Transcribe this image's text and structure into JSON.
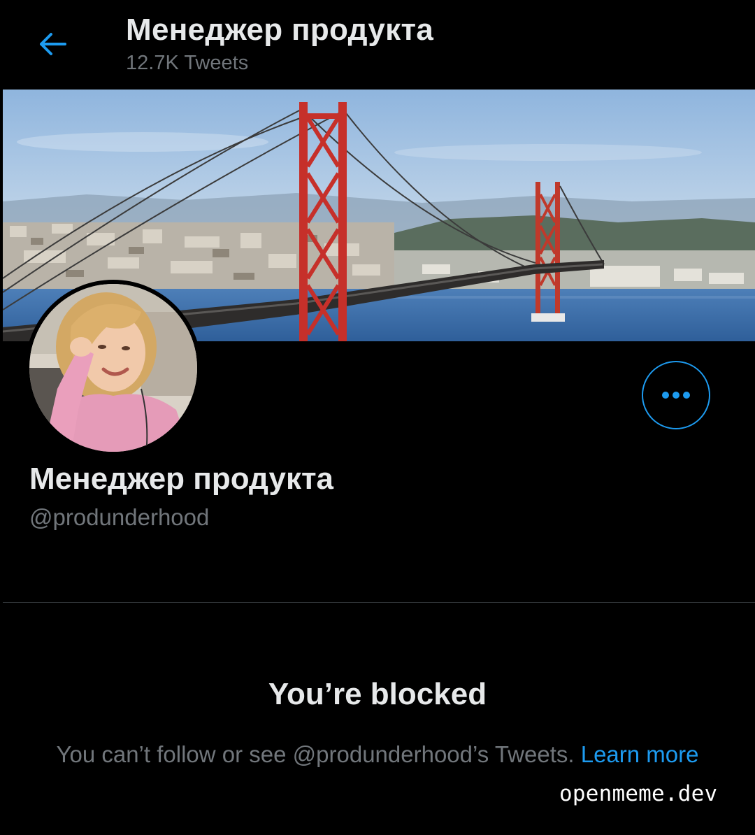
{
  "header": {
    "back_icon": "arrow-left-icon",
    "title": "Менеджер продукта",
    "tweet_count": "12.7K Tweets"
  },
  "profile": {
    "banner": "bridge-photo",
    "avatar": "profile-photo",
    "name": "Менеджер продукта",
    "handle": "@produnderhood",
    "more_icon": "ellipsis-icon"
  },
  "blocked": {
    "title": "You’re blocked",
    "message": "You can’t follow or see @produnderhood’s Tweets.",
    "link": "Learn more"
  },
  "watermark": "openmeme.dev",
  "colors": {
    "background": "#000000",
    "primary_text": "#e7e9ea",
    "secondary_text": "#71767b",
    "accent": "#1d9bf0",
    "divider": "#2f3336"
  }
}
